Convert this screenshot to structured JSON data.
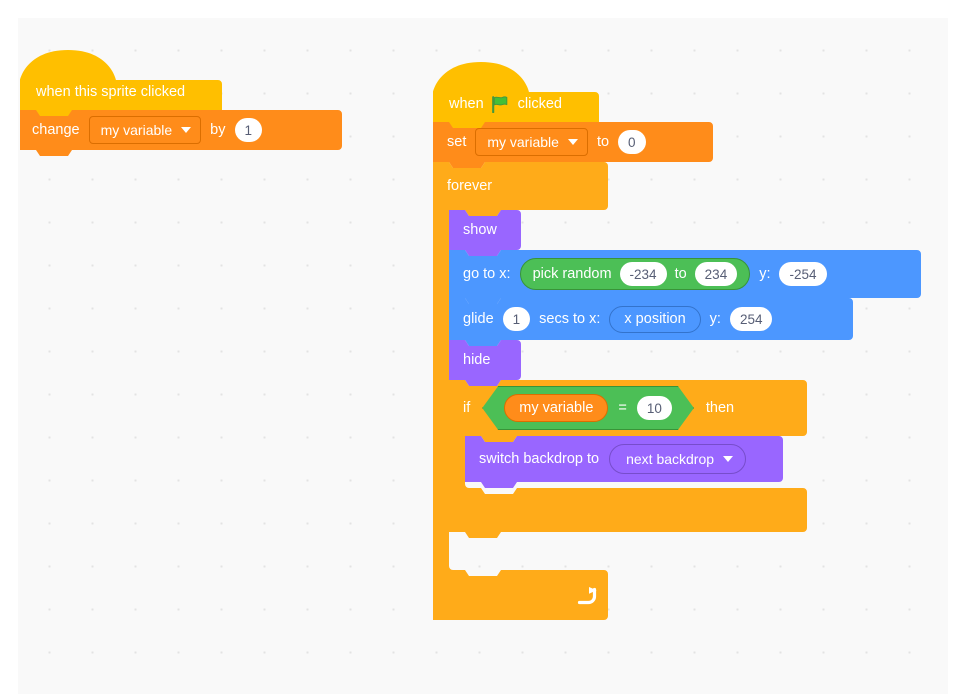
{
  "editor": {
    "name": "scratch-block-workspace",
    "background_color": "#f9f9f9",
    "grid_dot_color": "#e3e3e3"
  },
  "palette": {
    "events_yellow": "#ffbf00",
    "events_yellow_dark": "#e6ac00",
    "variables_orange": "#ff8c1a",
    "variables_orange_dark": "#db6e00",
    "control_orange": "#ffab19",
    "control_orange_dark": "#e89c17",
    "looks_purple": "#9966ff",
    "looks_purple_dark": "#855cd6",
    "motion_blue": "#4c97ff",
    "motion_blue_dark": "#3373cc",
    "operators_green": "#4cbf56",
    "operators_green_dark": "#389438",
    "input_white": "#ffffff",
    "input_text": "#575e75"
  },
  "scripts": [
    {
      "id": "script-sprite-clicked",
      "blocks": [
        {
          "name": "when-this-sprite-clicked-hat",
          "category": "events",
          "label": "when this sprite clicked"
        },
        {
          "name": "change-variable-by-block",
          "category": "variables",
          "label_before": "change",
          "variable": "my variable",
          "label_middle": "by",
          "value": "1"
        }
      ]
    },
    {
      "id": "script-green-flag",
      "blocks": [
        {
          "name": "when-green-flag-clicked-hat",
          "category": "events",
          "label_before": "when",
          "icon": "green-flag-icon",
          "label_after": "clicked"
        },
        {
          "name": "set-variable-to-block",
          "category": "variables",
          "label_before": "set",
          "variable": "my variable",
          "label_middle": "to",
          "value": "0"
        },
        {
          "name": "forever-block",
          "category": "control",
          "label": "forever",
          "loop_arrow_icon": "loop-arrow-icon",
          "children": [
            {
              "name": "show-block",
              "category": "looks",
              "label": "show"
            },
            {
              "name": "go-to-xy-block",
              "category": "motion",
              "label_x": "go to x:",
              "label_y": "y:",
              "y_value": "-254",
              "x_input": {
                "name": "pick-random-operator",
                "category": "operators",
                "label_before": "pick random",
                "from": "-234",
                "label_middle": "to",
                "to": "234"
              }
            },
            {
              "name": "glide-secs-to-xy-block",
              "category": "motion",
              "label_before": "glide",
              "secs": "1",
              "label_middle": "secs to x:",
              "x_reporter": "x position",
              "label_y": "y:",
              "y_value": "254"
            },
            {
              "name": "hide-block",
              "category": "looks",
              "label": "hide"
            },
            {
              "name": "if-then-block",
              "category": "control",
              "label_if": "if",
              "label_then": "then",
              "condition": {
                "name": "equals-operator",
                "category": "operators",
                "left": "my variable",
                "operator": "=",
                "right": "10"
              },
              "children": [
                {
                  "name": "switch-backdrop-to-block",
                  "category": "looks",
                  "label": "switch backdrop to",
                  "backdrop": "next backdrop"
                }
              ]
            }
          ]
        }
      ]
    }
  ]
}
